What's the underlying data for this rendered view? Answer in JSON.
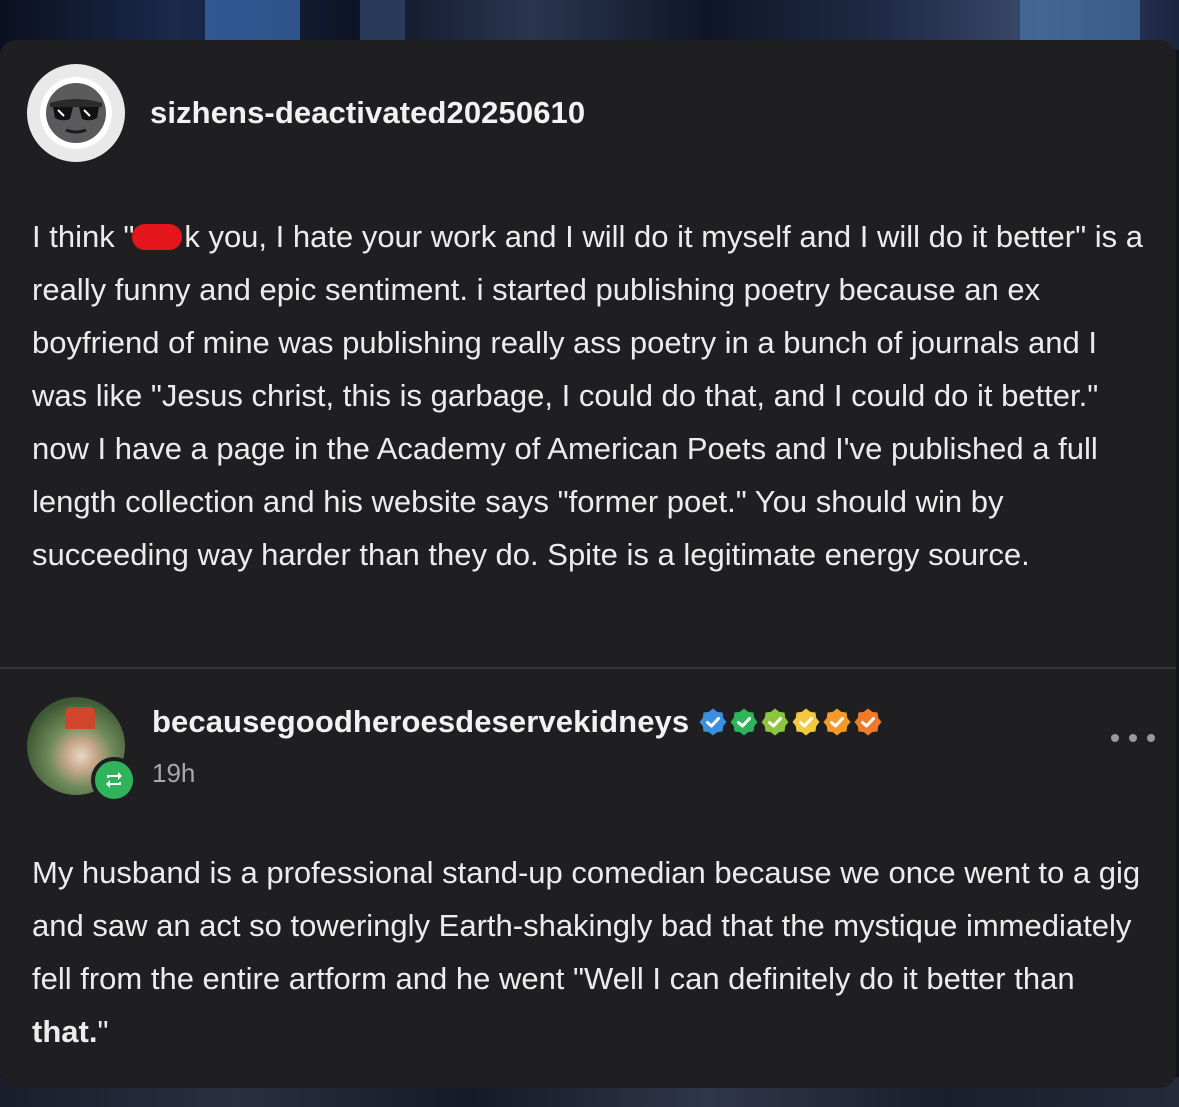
{
  "post1": {
    "username": "sizhens-deactivated20250610",
    "text_before_redaction": "I think \"",
    "text_after_redaction": "k you, I hate your work and I will do it myself and I will do it better\" is a really funny and epic sentiment. i started publishing poetry because an ex boyfriend of mine was publishing really ass poetry in a bunch of journals and I was like \"Jesus christ, this is garbage, I could do that, and I could do it better.\" now I have a page in the Academy of American Poets and I've published a full length collection and his website says \"former poet.\" You should win by succeeding way harder than they do. Spite is a legitimate energy source."
  },
  "post2": {
    "username": "becausegoodheroesdeservekidneys",
    "timestamp": "19h",
    "badge_colors": [
      "#3b8fe0",
      "#2fb45c",
      "#8cc63f",
      "#f5c842",
      "#f39a2a",
      "#f07a2a"
    ],
    "text_main": "My husband is a professional stand-up comedian because we once went to a gig and saw an act so toweringly Earth-shakingly bad that the mystique immediately fell from the entire artform and he went \"Well I can definitely do it better than ",
    "text_bold": "that.",
    "text_end": "\""
  },
  "icons": {
    "avatar1": "sunglasses-avatar-icon",
    "reblog": "reblog-icon",
    "more": "more-options-icon"
  },
  "colors": {
    "card": "#1f1f21",
    "text": "#ececec",
    "redaction": "#e4161b",
    "reblog_badge": "#2fb45c"
  }
}
